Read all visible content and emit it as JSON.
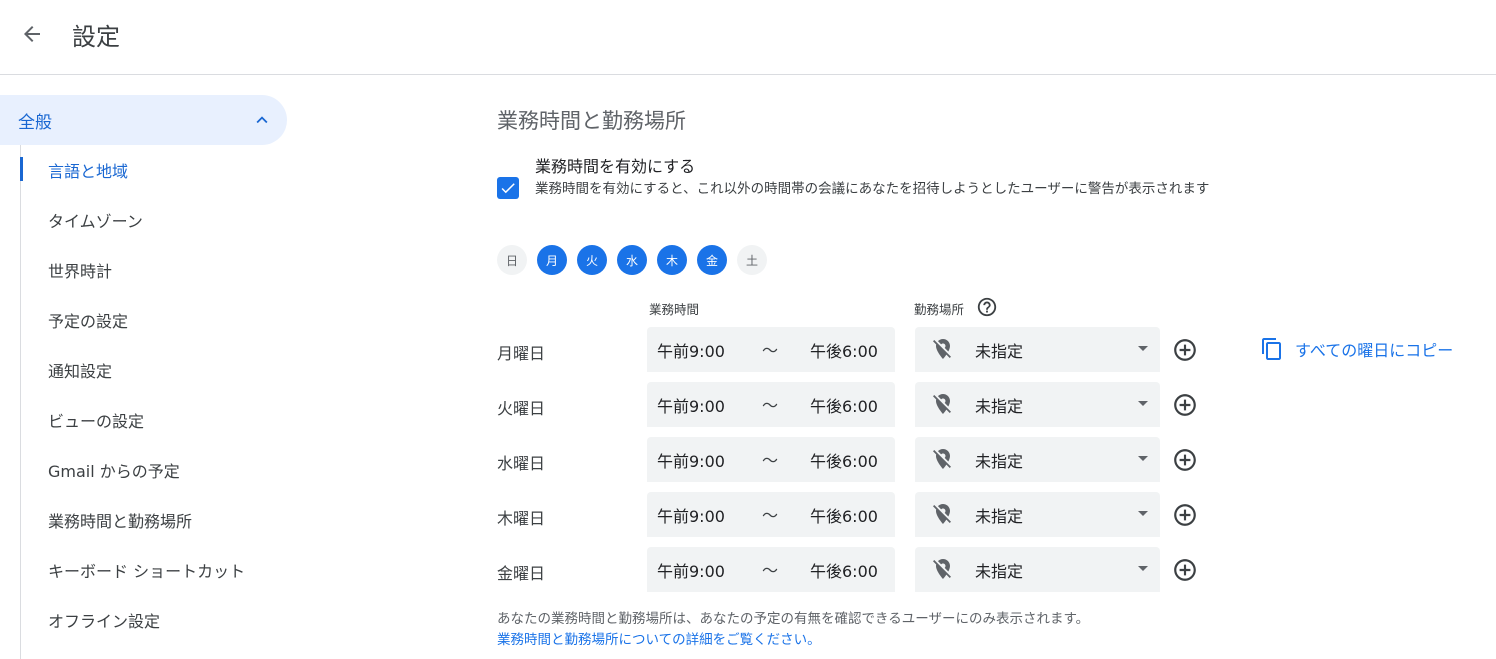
{
  "header": {
    "title": "設定"
  },
  "sidebar": {
    "section": "全般",
    "items": [
      {
        "label": "言語と地域"
      },
      {
        "label": "タイムゾーン"
      },
      {
        "label": "世界時計"
      },
      {
        "label": "予定の設定"
      },
      {
        "label": "通知設定"
      },
      {
        "label": "ビューの設定"
      },
      {
        "label": "Gmail からの予定"
      },
      {
        "label": "業務時間と勤務場所"
      },
      {
        "label": "キーボード ショートカット"
      },
      {
        "label": "オフライン設定"
      }
    ]
  },
  "main": {
    "section_title": "業務時間と勤務場所",
    "enable": {
      "label": "業務時間を有効にする",
      "description": "業務時間を有効にすると、これ以外の時間帯の会議にあなたを招待しようとしたユーザーに警告が表示されます"
    },
    "days": [
      "日",
      "月",
      "火",
      "水",
      "木",
      "金",
      "土"
    ],
    "col_hours": "業務時間",
    "col_location": "勤務場所",
    "tilde": "〜",
    "rows": [
      {
        "day": "月曜日",
        "from": "午前9:00",
        "to": "午後6:00",
        "location": "未指定"
      },
      {
        "day": "火曜日",
        "from": "午前9:00",
        "to": "午後6:00",
        "location": "未指定"
      },
      {
        "day": "水曜日",
        "from": "午前9:00",
        "to": "午後6:00",
        "location": "未指定"
      },
      {
        "day": "木曜日",
        "from": "午前9:00",
        "to": "午後6:00",
        "location": "未指定"
      },
      {
        "day": "金曜日",
        "from": "午前9:00",
        "to": "午後6:00",
        "location": "未指定"
      }
    ],
    "copy_all": "すべての曜日にコピー",
    "footnote": "あなたの業務時間と勤務場所は、あなたの予定の有無を確認できるユーザーにのみ表示されます。",
    "footlink": "業務時間と勤務場所についての詳細をご覧ください。"
  },
  "colors": {
    "accent": "#1a73e8",
    "active_bg": "#e8f0fe",
    "field_bg": "#f1f3f4"
  },
  "icons": [
    "arrow-back-icon",
    "chevron-up-icon",
    "check-icon",
    "help-icon",
    "location-off-icon",
    "add-circle-icon",
    "copy-icon"
  ]
}
